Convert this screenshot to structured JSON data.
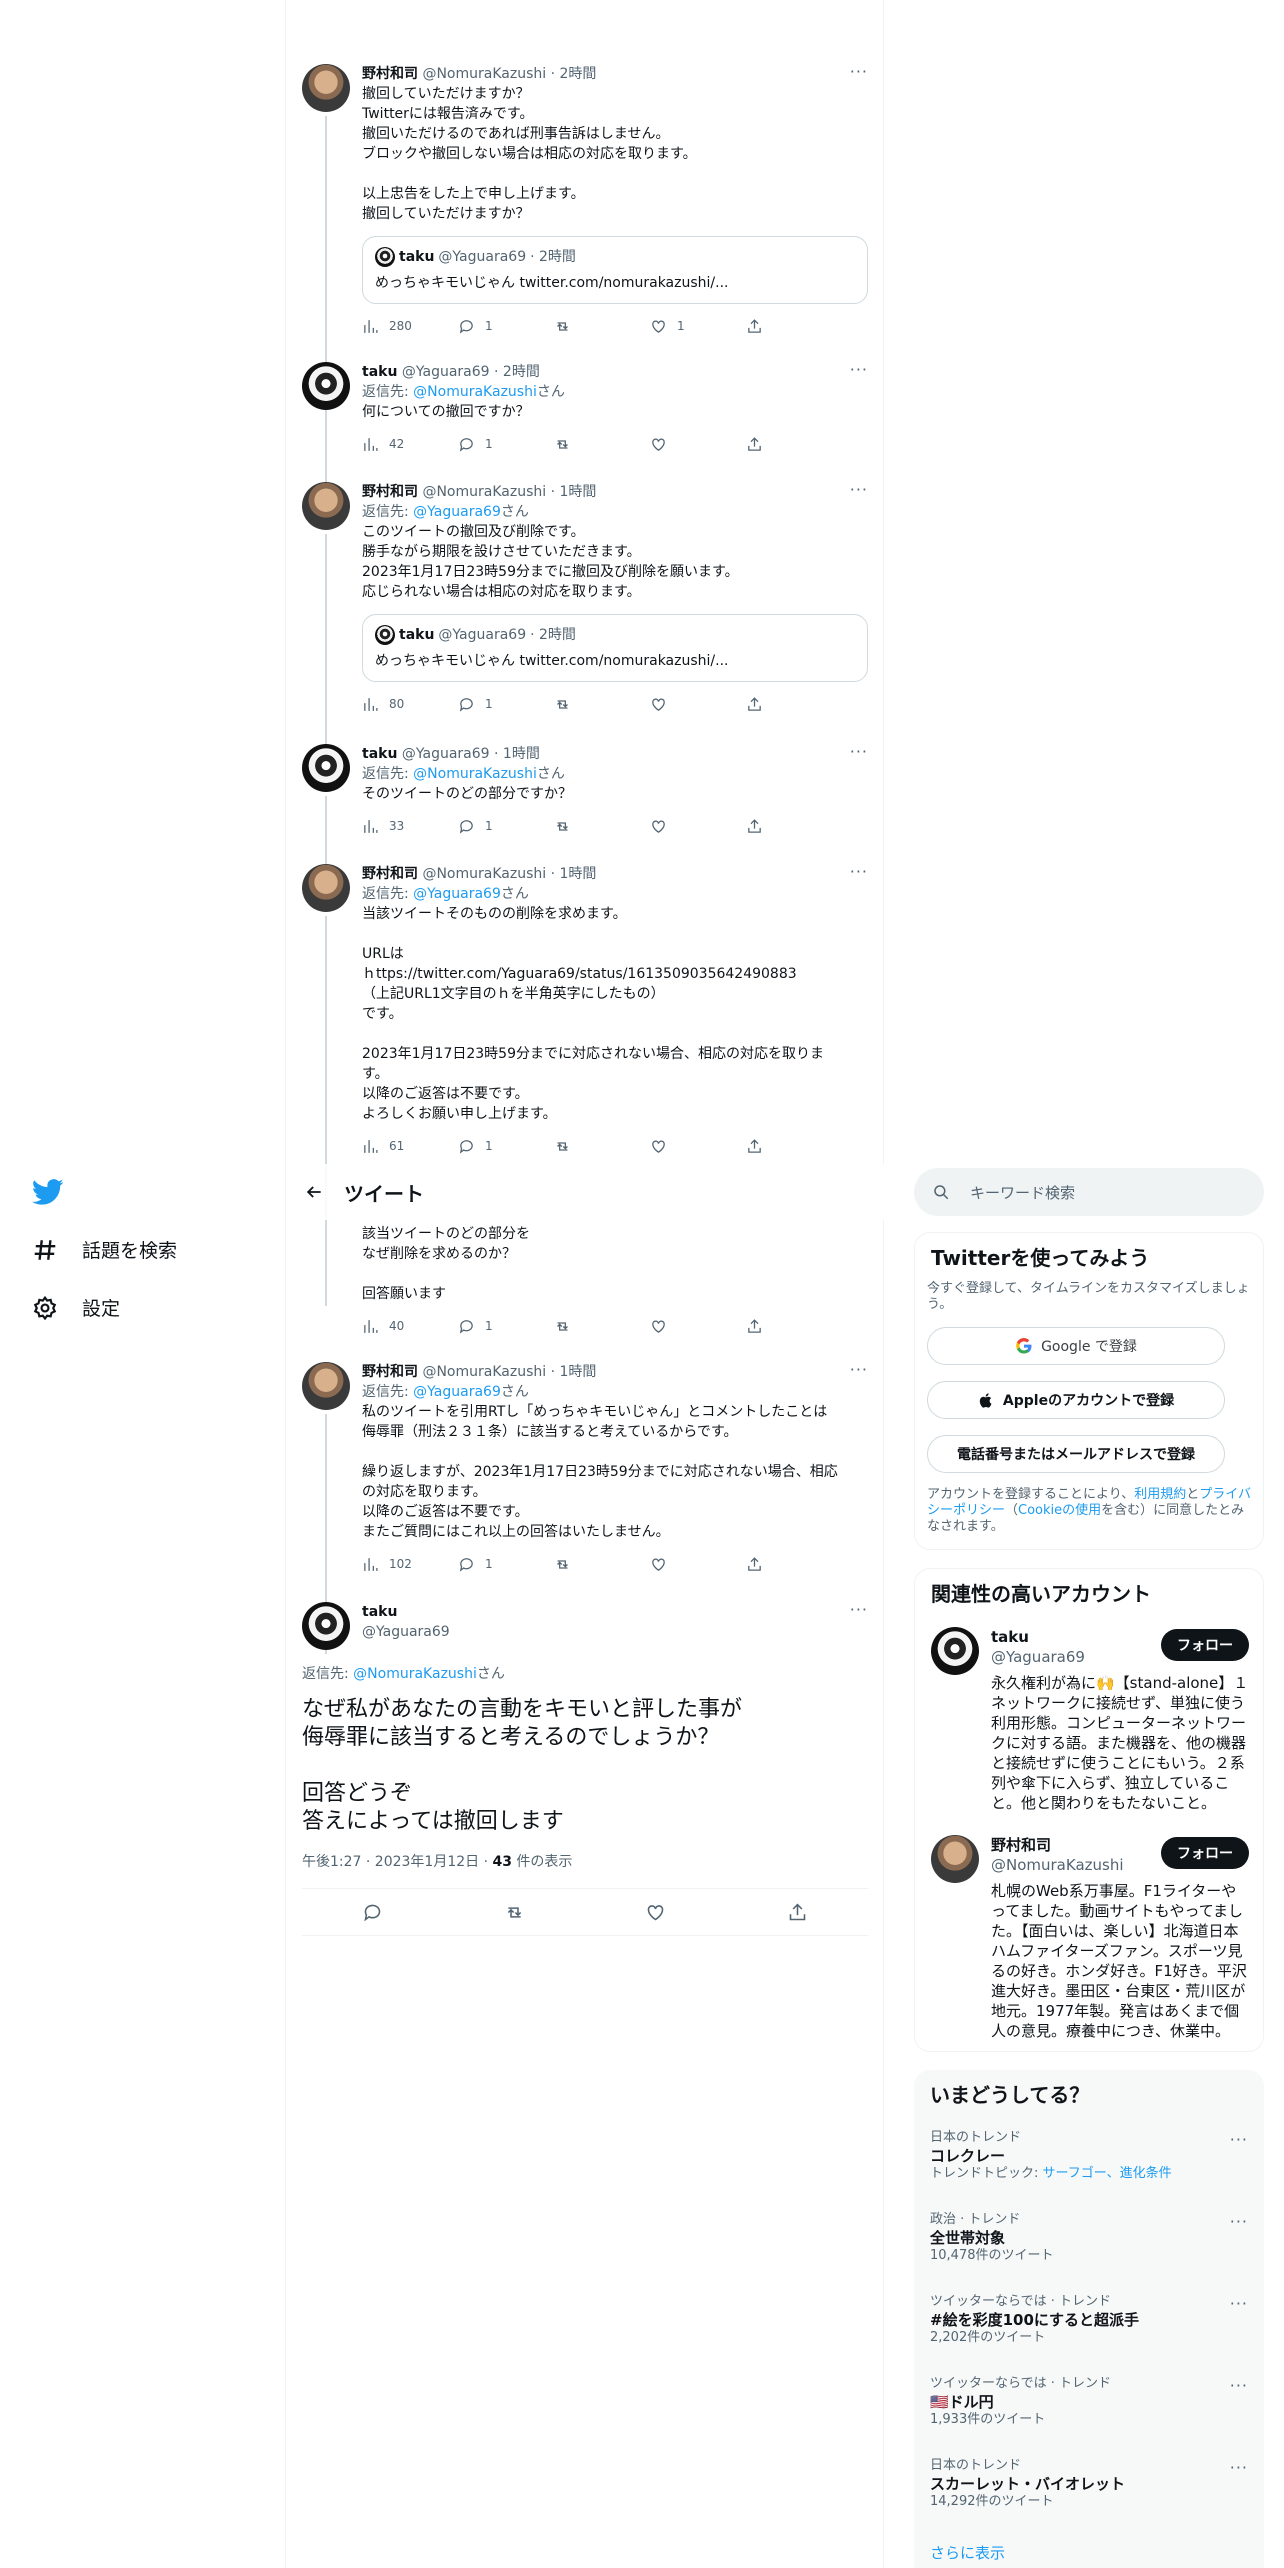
{
  "nav": {
    "explore_label": "話題を検索",
    "settings_label": "設定"
  },
  "header": {
    "title": "ツイート"
  },
  "thread": [
    {
      "name": "野村和司",
      "handle": "@NomuraKazushi",
      "time": "· 2時間",
      "reply_prefix": "",
      "reply_link": "",
      "reply_suffix": "",
      "text": "撤回していただけますか？\nTwitterには報告済みです。\n撤回いただけるのであれば刑事告訴はしません。\nブロックや撤回しない場合は相応の対応を取ります。\n\n以上忠告をした上で申し上げます。\n撤回していただけますか？",
      "quote": {
        "name": "taku",
        "handle": "@Yaguara69",
        "time": "· 2時間",
        "text": "めっちゃキモいじゃん twitter.com/nomurakazushi/..."
      },
      "views": "280",
      "replies": "1",
      "retweets": "",
      "likes": "1"
    },
    {
      "name": "taku",
      "handle": "@Yaguara69",
      "time": "· 2時間",
      "reply_prefix": "返信先: ",
      "reply_link": "@NomuraKazushi",
      "reply_suffix": "さん",
      "text": "何についての撤回ですか？",
      "views": "42",
      "replies": "1",
      "retweets": "",
      "likes": ""
    },
    {
      "name": "野村和司",
      "handle": "@NomuraKazushi",
      "time": "· 1時間",
      "reply_prefix": "返信先: ",
      "reply_link": "@Yaguara69",
      "reply_suffix": "さん",
      "text": "このツイートの撤回及び削除です。\n勝手ながら期限を設けさせていただきます。\n2023年1月17日23時59分までに撤回及び削除を願います。\n応じられない場合は相応の対応を取ります。",
      "quote": {
        "name": "taku",
        "handle": "@Yaguara69",
        "time": "· 2時間",
        "text": "めっちゃキモいじゃん twitter.com/nomurakazushi/..."
      },
      "views": "80",
      "replies": "1",
      "retweets": "",
      "likes": ""
    },
    {
      "name": "taku",
      "handle": "@Yaguara69",
      "time": "· 1時間",
      "reply_prefix": "返信先: ",
      "reply_link": "@NomuraKazushi",
      "reply_suffix": "さん",
      "text": "そのツイートのどの部分ですか？",
      "views": "33",
      "replies": "1",
      "retweets": "",
      "likes": ""
    },
    {
      "name": "野村和司",
      "handle": "@NomuraKazushi",
      "time": "· 1時間",
      "reply_prefix": "返信先: ",
      "reply_link": "@Yaguara69",
      "reply_suffix": "さん",
      "text": "当該ツイートそのものの削除を求めます。\n\nURLは\nｈttps://twitter.com/Yaguara69/status/1613509035642490883\n（上記URL1文字目のｈを半角英字にしたもの）\nです。\n\n2023年1月17日23時59分までに対応されない場合、相応の対応を取りま\nす。\n以降のご返答は不要です。\nよろしくお願い申し上げます。",
      "views": "61",
      "replies": "1",
      "retweets": "",
      "likes": ""
    },
    {
      "partial": true,
      "text": "該当ツイートのどの部分を\nなぜ削除を求めるのか？\n\n回答願います",
      "views": "40",
      "replies": "1",
      "retweets": "",
      "likes": ""
    },
    {
      "name": "野村和司",
      "handle": "@NomuraKazushi",
      "time": "· 1時間",
      "reply_prefix": "返信先: ",
      "reply_link": "@Yaguara69",
      "reply_suffix": "さん",
      "text": "私のツイートを引用RTし「めっちゃキモいじゃん」とコメントしたことは\n侮辱罪（刑法２３１条）に該当すると考えているからです。\n\n繰り返しますが、2023年1月17日23時59分までに対応されない場合、相応\nの対応を取ります。\n以降のご返答は不要です。\nまたご質問にはこれ以上の回答はいたしません。",
      "views": "102",
      "replies": "1",
      "retweets": "",
      "likes": ""
    }
  ],
  "focal": {
    "name": "taku",
    "handle": "@Yaguara69",
    "reply_prefix": "返信先: ",
    "reply_link": "@NomuraKazushi",
    "reply_suffix": "さん",
    "text": "なぜ私があなたの言動をキモいと評した事が\n侮辱罪に該当すると考えるのでしょうか？\n\n回答どうぞ\n答えによっては撤回します",
    "meta_time": "午後1:27 · 2023年1月12日 · ",
    "meta_views": "43",
    "meta_views_label": " 件の表示"
  },
  "search": {
    "placeholder": "キーワード検索"
  },
  "signup": {
    "title": "Twitterを使ってみよう",
    "subtitle": "今すぐ登録して、タイムラインをカスタマイズしましょう。",
    "google_label": "Google で登録",
    "apple_label": "Appleのアカウントで登録",
    "phone_label": "電話番号またはメールアドレスで登録",
    "legal_prefix": "アカウントを登録することにより、",
    "legal_terms": "利用規約",
    "legal_and": "と",
    "legal_privacy": "プライバシーポリシー",
    "legal_mid": "（",
    "legal_cookie": "Cookieの使用",
    "legal_suffix": "を含む）に同意したとみなされます。"
  },
  "related": {
    "title": "関連性の高いアカウント",
    "accounts": [
      {
        "name": "taku",
        "handle": "@Yaguara69",
        "follow": "フォロー",
        "bio": "永久権利が為に🙌【stand-alone】１ネットワークに接続せず、単独に使う利用形態。コンピューターネットワークに対する語。また機器を、他の機器と接続せずに使うことにもいう。２系列や傘下に入らず、独立していること。他と関わりをもたないこと。"
      },
      {
        "name": "野村和司",
        "handle": "@NomuraKazushi",
        "follow": "フォロー",
        "bio": "札幌のWeb系万事屋。F1ライターやってました。動画サイトもやってました。【面白いは、楽しい】北海道日本ハムファイターズファン。スポーツ見るの好き。ホンダ好き。F1好き。平沢進大好き。墨田区・台東区・荒川区が地元。1977年製。発言はあくまで個人の意見。療養中につき、休業中。"
      }
    ]
  },
  "trends": {
    "title": "いまどうしてる？",
    "items": [
      {
        "context": "日本のトレンド",
        "name": "コレクレー",
        "count_prefix": "トレンドトピック: ",
        "count_link": "サーフゴー、進化条件",
        "count": ""
      },
      {
        "context": "政治 · トレンド",
        "name": "全世帯対象",
        "count_prefix": "",
        "count_link": "",
        "count": "10,478件のツイート"
      },
      {
        "context": "ツイッターならでは · トレンド",
        "name": "#絵を彩度100にすると超派手",
        "count_prefix": "",
        "count_link": "",
        "count": "2,202件のツイート"
      },
      {
        "context": "ツイッターならでは · トレンド",
        "name": "🇺🇸ドル円",
        "count_prefix": "",
        "count_link": "",
        "count": "1,933件のツイート"
      },
      {
        "context": "日本のトレンド",
        "name": "スカーレット・バイオレット",
        "count_prefix": "",
        "count_link": "",
        "count": "14,292件のツイート"
      }
    ],
    "show_more": "さらに表示"
  },
  "colors": {
    "accent": "#1d9bf0",
    "text": "#0f1419",
    "muted": "#536471",
    "border": "#eff3f4"
  }
}
